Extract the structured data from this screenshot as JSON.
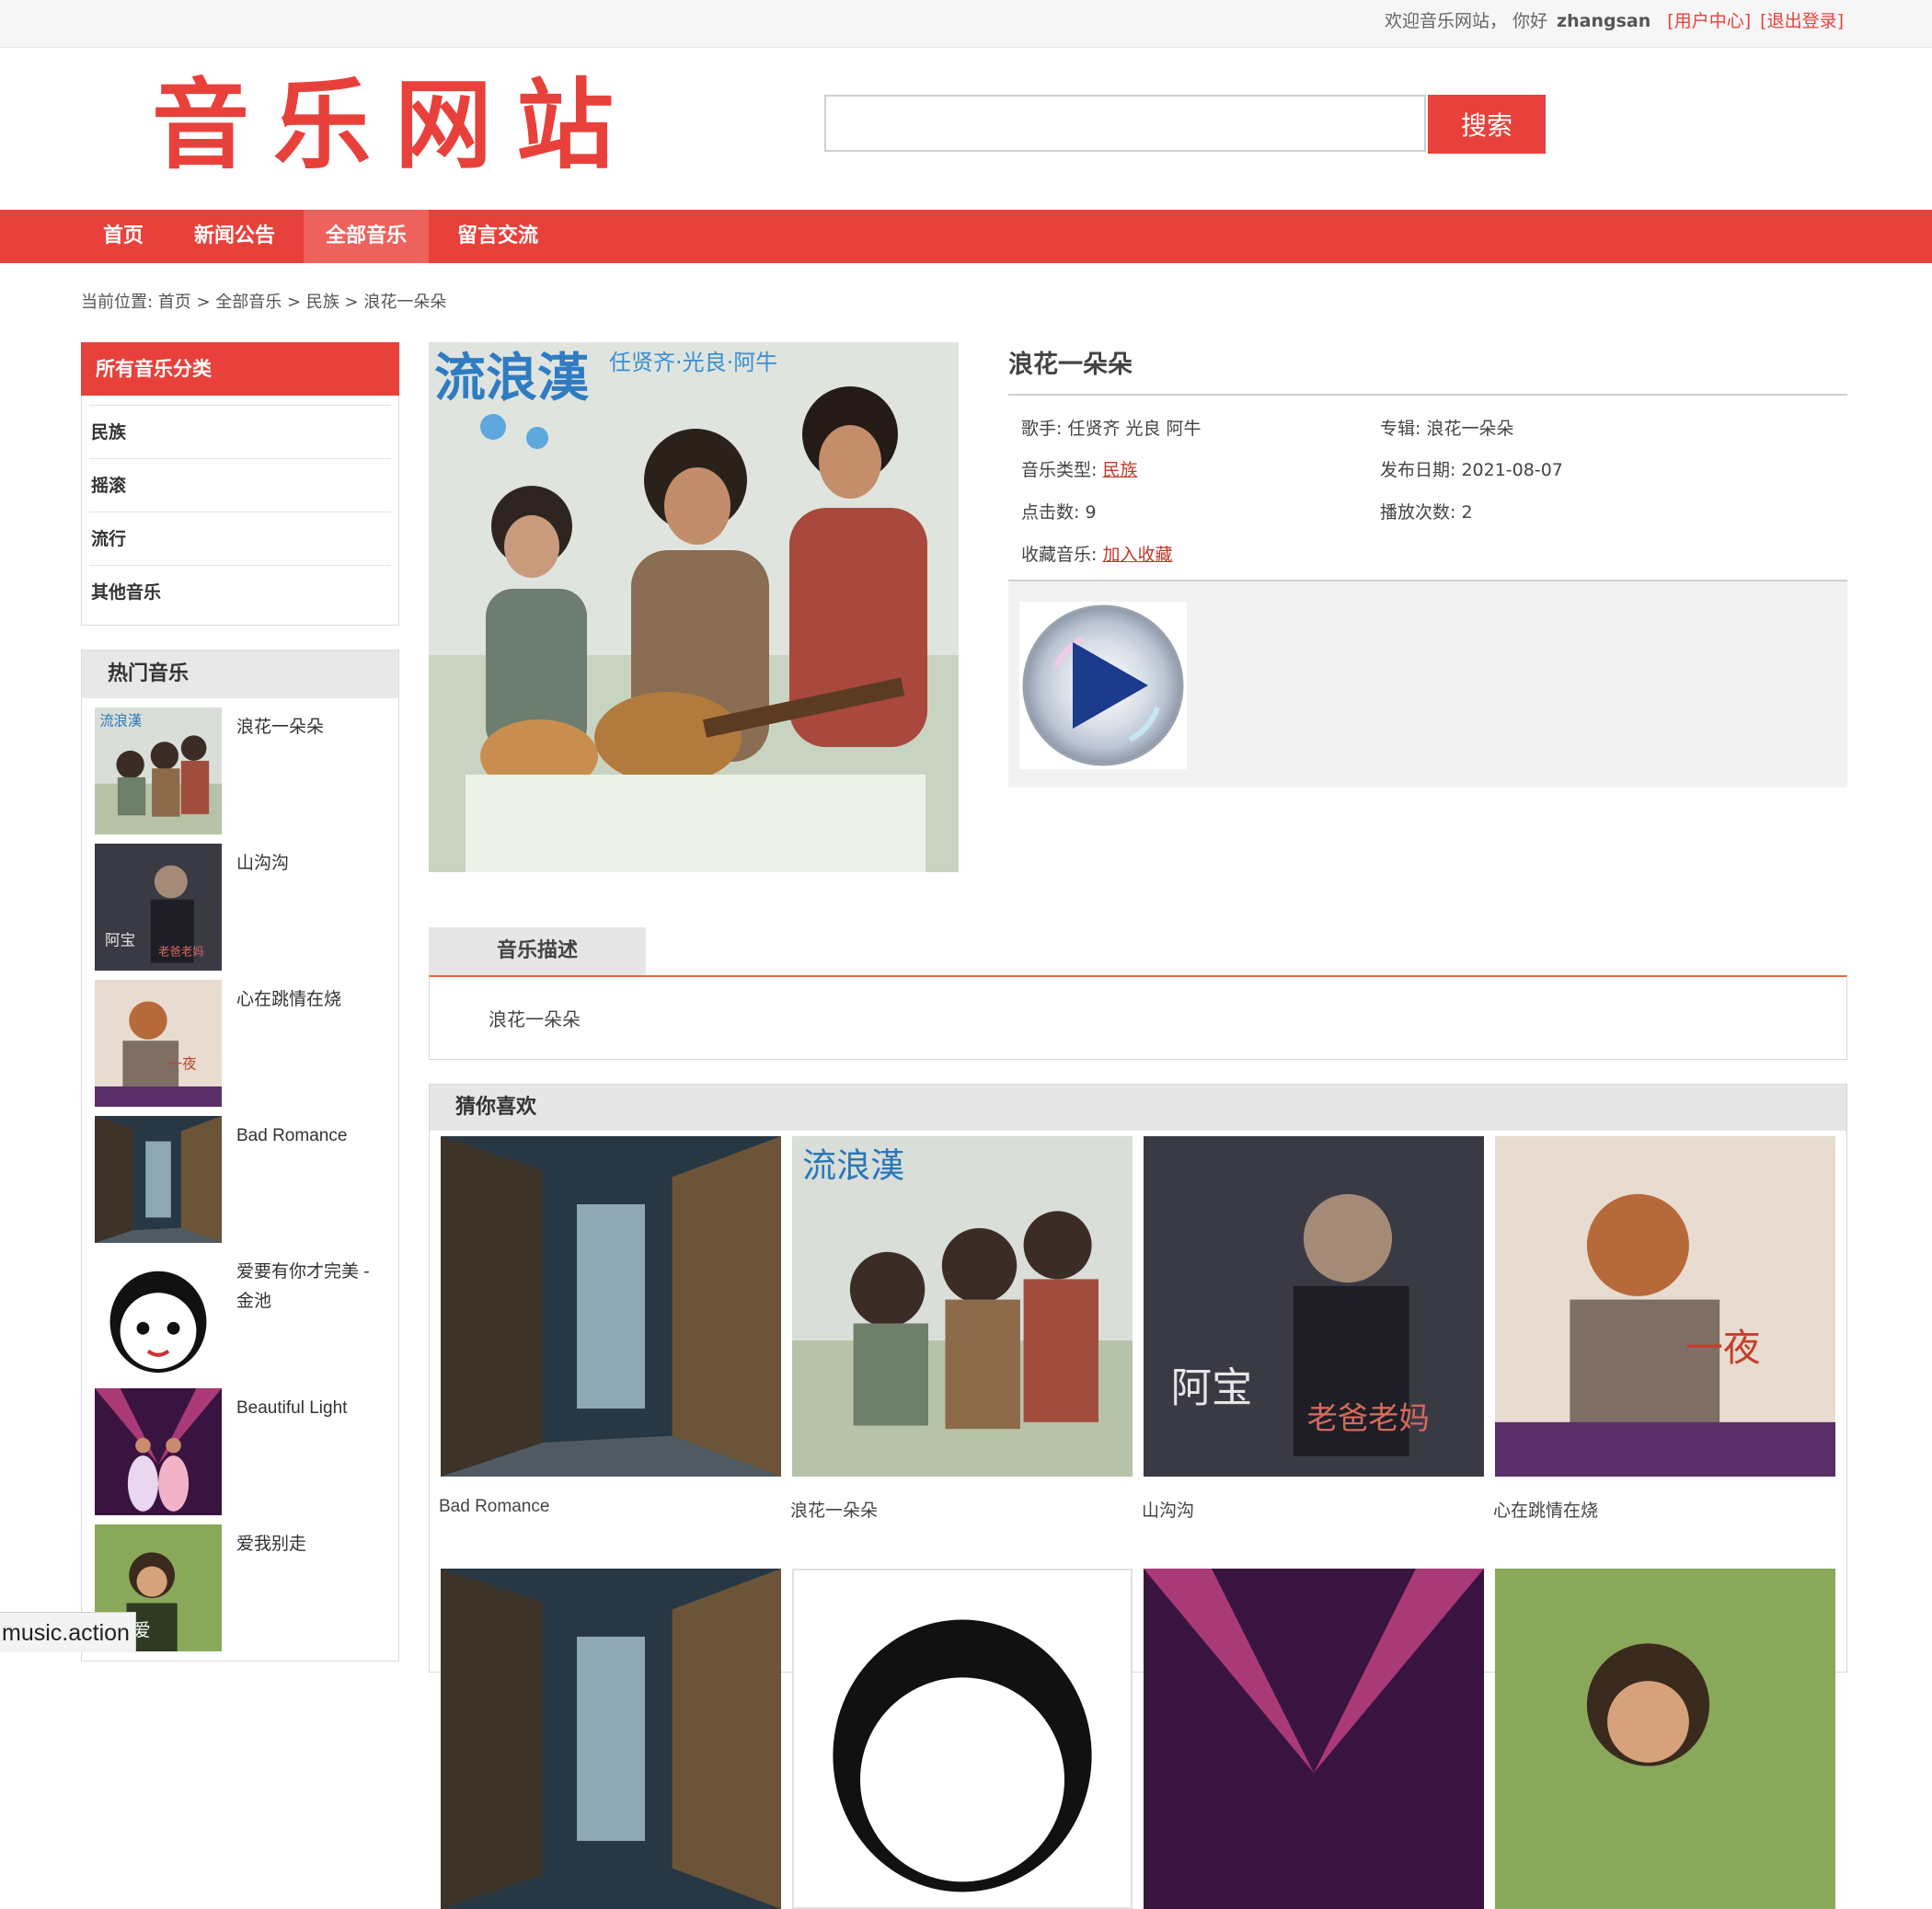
{
  "topbar": {
    "welcome": "欢迎音乐网站，  你好",
    "username": "zhangsan",
    "user_center": "[用户中心]",
    "logout": "[退出登录]"
  },
  "header": {
    "logo": "音乐网站",
    "search_value": "",
    "search_button": "搜索"
  },
  "nav": {
    "items": [
      "首页",
      "新闻公告",
      "全部音乐",
      "留言交流"
    ],
    "active": "全部音乐"
  },
  "breadcrumb": "当前位置: 首页 > 全部音乐 > 民族 > 浪花一朵朵",
  "sidebar": {
    "categories_title": "所有音乐分类",
    "categories": [
      "民族",
      "摇滚",
      "流行",
      "其他音乐"
    ],
    "hot_title": "热门音乐",
    "hot": [
      {
        "title": "浪花一朵朵",
        "cover": "band-cover"
      },
      {
        "title": "山沟沟",
        "cover": "singer-cover"
      },
      {
        "title": "心在跳情在烧",
        "cover": "orange-cover"
      },
      {
        "title": "Bad Romance",
        "cover": "street-cover"
      },
      {
        "title": "爱要有你才完美 - 金池",
        "cover": "cartoon-cover"
      },
      {
        "title": "Beautiful Light",
        "cover": "stage-cover"
      },
      {
        "title": "爱我别走",
        "cover": "green-cover"
      }
    ]
  },
  "song": {
    "title": "浪花一朵朵",
    "cover_text": "流浪漢",
    "cover_names": "任贤齐·光良·阿牛",
    "singer_label": "歌手:",
    "singer": "任贤齐 光良 阿牛",
    "album_label": "专辑:",
    "album": "浪花一朵朵",
    "type_label": "音乐类型:",
    "type": "民族",
    "date_label": "发布日期:",
    "date": "2021-08-07",
    "clicks_label": "点击数:",
    "clicks": "9",
    "plays_label": "播放次数:",
    "plays": "2",
    "fav_label": "收藏音乐:",
    "fav_link": "加入收藏"
  },
  "description": {
    "tab": "音乐描述",
    "text": "浪花一朵朵"
  },
  "recommend": {
    "title": "猜你喜欢",
    "items": [
      {
        "title": "Bad Romance",
        "cover": "street-cover"
      },
      {
        "title": "浪花一朵朵",
        "cover": "band-cover"
      },
      {
        "title": "山沟沟",
        "cover": "singer-cover"
      },
      {
        "title": "心在跳情在烧",
        "cover": "orange-cover"
      },
      {
        "title": "",
        "cover": "street-cover"
      },
      {
        "title": "",
        "cover": "cartoon-cover"
      },
      {
        "title": "",
        "cover": "stage-cover"
      },
      {
        "title": "",
        "cover": "green-cover"
      }
    ]
  },
  "statusbar": "music.action",
  "colors": {
    "brand": "#e8413b",
    "nav_active": "#ee625d",
    "link": "#c0392b"
  }
}
